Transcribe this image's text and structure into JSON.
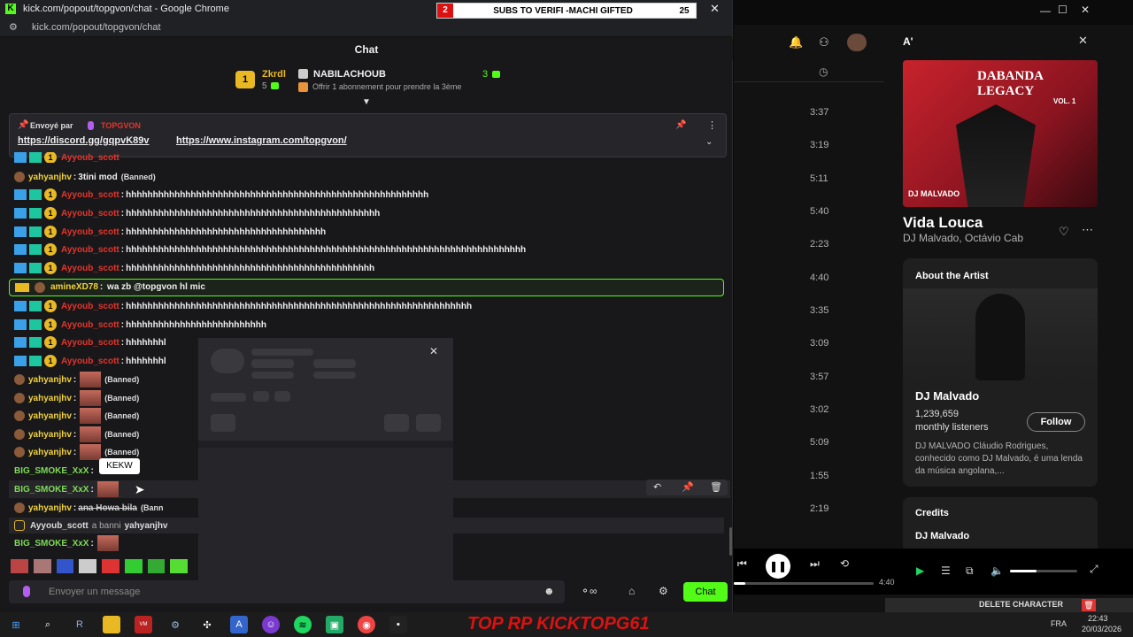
{
  "window": {
    "title": "kick.com/popout/topgvon/chat - Google Chrome",
    "url": "kick.com/popout/topgvon/chat",
    "minimize": "—",
    "close": "✕"
  },
  "subs_banner": {
    "num": "2",
    "text": "SUBS TO VERIFI -MACHI GIFTED",
    "count": "25"
  },
  "chat": {
    "header": "Chat",
    "leader": {
      "rank": "1",
      "name": "Zkrdl",
      "count": "5",
      "second_name": "NABILACHOUB",
      "second_count": "3",
      "offer": "Offrir 1 abonnement pour prendre la 3ème"
    },
    "pinned": {
      "label": "Envoyé par",
      "sender": "TOPGVON",
      "link1": "https://discord.gg/gqpvK89v",
      "link2": "https://www.instagram.com/topgvon/"
    },
    "messages": [
      {
        "user": "yahyanjhv",
        "text": "3tini mod",
        "tag": "(Banned)"
      },
      {
        "user": "Ayyoub_scott",
        "text": "hhhhhhhhhhhhhhhhhhhhhhhhhhhhhhhhhhhhhhhhhhhhhhhhhhhhhhhh"
      },
      {
        "user": "Ayyoub_scott",
        "text": "hhhhhhhhhhhhhhhhhhhhhhhhhhhhhhhhhhhhhhhhhhhhhhh"
      },
      {
        "user": "Ayyoub_scott",
        "text": "hhhhhhhhhhhhhhhhhhhhhhhhhhhhhhhhhhhhh"
      },
      {
        "user": "Ayyoub_scott",
        "text": "hhhhhhhhhhhhhhhhhhhhhhhhhhhhhhhhhhhhhhhhhhhhhhhhhhhhhhhhhhhhhhhhhhhhhhhhhh"
      },
      {
        "user": "Ayyoub_scott",
        "text": "hhhhhhhhhhhhhhhhhhhhhhhhhhhhhhhhhhhhhhhhhhhhhh"
      },
      {
        "user": "amineXD78",
        "text": "wa zb @topgvon hl mic"
      },
      {
        "user": "Ayyoub_scott",
        "text": "hhhhhhhhhhhhhhhhhhhhhhhhhhhhhhhhhhhhhhhhhhhhhhhhhhhhhhhhhhhhhhhh"
      },
      {
        "user": "Ayyoub_scott",
        "text": "hhhhhhhhhhhhhhhhhhhhhhhhhh"
      },
      {
        "user": "Ayyoub_scott",
        "text": "hhhhhhhl"
      },
      {
        "user": "Ayyoub_scott",
        "text": "hhhhhhhl"
      },
      {
        "user": "yahyanjhv",
        "tag": "(Banned)"
      },
      {
        "user": "yahyanjhv",
        "tag": "(Banned)"
      },
      {
        "user": "yahyanjhv",
        "tag": "(Banned)"
      },
      {
        "user": "yahyanjhv",
        "tag": "(Banned)"
      },
      {
        "user": "yahyanjhv",
        "tag": "(Banned)"
      },
      {
        "user": "BIG_SMOKE_XxX",
        "tooltip": "KEKW"
      },
      {
        "user": "BIG_SMOKE_XxX"
      },
      {
        "user": "yahyanjhv",
        "text": "ana Howa bila",
        "tag": "(Bann"
      },
      {
        "user": "Ayyoub_scott",
        "text": "a banni",
        "target": "yahyanjhv"
      },
      {
        "user": "BIG_SMOKE_XxX"
      }
    ],
    "input_placeholder": "Envoyer un message",
    "send_label": "Chat"
  },
  "spotify": {
    "durations": [
      "3:37",
      "3:19",
      "5:11",
      "5:40",
      "2:23",
      "4:40",
      "3:35",
      "3:09",
      "3:57",
      "3:02",
      "5:09",
      "1:55",
      "2:19"
    ],
    "panel_header": "A'",
    "album_title": "DABANDA LEGACY",
    "album_sub": "VOL. 1",
    "album_artist": "DJ MALVADO",
    "track_title": "Vida Louca",
    "track_artists": "DJ Malvado, Octávio Cab",
    "about_label": "About the Artist",
    "artist_name": "DJ Malvado",
    "listeners_num": "1,239,659",
    "listeners_label": "monthly listeners",
    "follow_label": "Follow",
    "bio": "DJ MALVADO Cláudio Rodrigues, conhecido como DJ Malvado, é uma lenda da música angolana,...",
    "credits_label": "Credits",
    "credits_artist": "DJ Malvado",
    "elapsed": "4:40"
  },
  "overlay": {
    "delete_label": "DELETE CHARACTER",
    "brand": "TOP RP KICKTOPG61"
  },
  "taskbar": {
    "lang": "FRA",
    "time": "22:43",
    "date": "20/03/2026"
  }
}
